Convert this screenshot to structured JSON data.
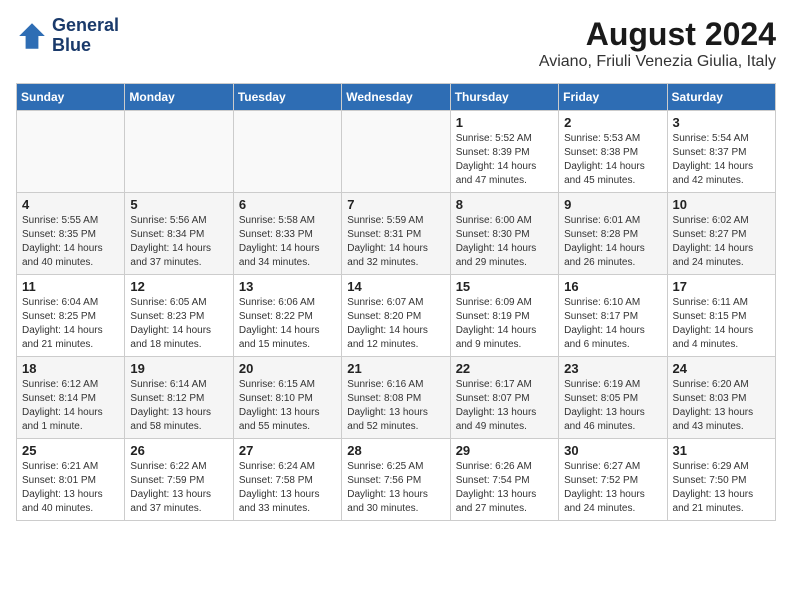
{
  "header": {
    "logo_line1": "General",
    "logo_line2": "Blue",
    "month_title": "August 2024",
    "location": "Aviano, Friuli Venezia Giulia, Italy"
  },
  "days_of_week": [
    "Sunday",
    "Monday",
    "Tuesday",
    "Wednesday",
    "Thursday",
    "Friday",
    "Saturday"
  ],
  "weeks": [
    [
      {
        "day": "",
        "detail": ""
      },
      {
        "day": "",
        "detail": ""
      },
      {
        "day": "",
        "detail": ""
      },
      {
        "day": "",
        "detail": ""
      },
      {
        "day": "1",
        "detail": "Sunrise: 5:52 AM\nSunset: 8:39 PM\nDaylight: 14 hours\nand 47 minutes."
      },
      {
        "day": "2",
        "detail": "Sunrise: 5:53 AM\nSunset: 8:38 PM\nDaylight: 14 hours\nand 45 minutes."
      },
      {
        "day": "3",
        "detail": "Sunrise: 5:54 AM\nSunset: 8:37 PM\nDaylight: 14 hours\nand 42 minutes."
      }
    ],
    [
      {
        "day": "4",
        "detail": "Sunrise: 5:55 AM\nSunset: 8:35 PM\nDaylight: 14 hours\nand 40 minutes."
      },
      {
        "day": "5",
        "detail": "Sunrise: 5:56 AM\nSunset: 8:34 PM\nDaylight: 14 hours\nand 37 minutes."
      },
      {
        "day": "6",
        "detail": "Sunrise: 5:58 AM\nSunset: 8:33 PM\nDaylight: 14 hours\nand 34 minutes."
      },
      {
        "day": "7",
        "detail": "Sunrise: 5:59 AM\nSunset: 8:31 PM\nDaylight: 14 hours\nand 32 minutes."
      },
      {
        "day": "8",
        "detail": "Sunrise: 6:00 AM\nSunset: 8:30 PM\nDaylight: 14 hours\nand 29 minutes."
      },
      {
        "day": "9",
        "detail": "Sunrise: 6:01 AM\nSunset: 8:28 PM\nDaylight: 14 hours\nand 26 minutes."
      },
      {
        "day": "10",
        "detail": "Sunrise: 6:02 AM\nSunset: 8:27 PM\nDaylight: 14 hours\nand 24 minutes."
      }
    ],
    [
      {
        "day": "11",
        "detail": "Sunrise: 6:04 AM\nSunset: 8:25 PM\nDaylight: 14 hours\nand 21 minutes."
      },
      {
        "day": "12",
        "detail": "Sunrise: 6:05 AM\nSunset: 8:23 PM\nDaylight: 14 hours\nand 18 minutes."
      },
      {
        "day": "13",
        "detail": "Sunrise: 6:06 AM\nSunset: 8:22 PM\nDaylight: 14 hours\nand 15 minutes."
      },
      {
        "day": "14",
        "detail": "Sunrise: 6:07 AM\nSunset: 8:20 PM\nDaylight: 14 hours\nand 12 minutes."
      },
      {
        "day": "15",
        "detail": "Sunrise: 6:09 AM\nSunset: 8:19 PM\nDaylight: 14 hours\nand 9 minutes."
      },
      {
        "day": "16",
        "detail": "Sunrise: 6:10 AM\nSunset: 8:17 PM\nDaylight: 14 hours\nand 6 minutes."
      },
      {
        "day": "17",
        "detail": "Sunrise: 6:11 AM\nSunset: 8:15 PM\nDaylight: 14 hours\nand 4 minutes."
      }
    ],
    [
      {
        "day": "18",
        "detail": "Sunrise: 6:12 AM\nSunset: 8:14 PM\nDaylight: 14 hours\nand 1 minute."
      },
      {
        "day": "19",
        "detail": "Sunrise: 6:14 AM\nSunset: 8:12 PM\nDaylight: 13 hours\nand 58 minutes."
      },
      {
        "day": "20",
        "detail": "Sunrise: 6:15 AM\nSunset: 8:10 PM\nDaylight: 13 hours\nand 55 minutes."
      },
      {
        "day": "21",
        "detail": "Sunrise: 6:16 AM\nSunset: 8:08 PM\nDaylight: 13 hours\nand 52 minutes."
      },
      {
        "day": "22",
        "detail": "Sunrise: 6:17 AM\nSunset: 8:07 PM\nDaylight: 13 hours\nand 49 minutes."
      },
      {
        "day": "23",
        "detail": "Sunrise: 6:19 AM\nSunset: 8:05 PM\nDaylight: 13 hours\nand 46 minutes."
      },
      {
        "day": "24",
        "detail": "Sunrise: 6:20 AM\nSunset: 8:03 PM\nDaylight: 13 hours\nand 43 minutes."
      }
    ],
    [
      {
        "day": "25",
        "detail": "Sunrise: 6:21 AM\nSunset: 8:01 PM\nDaylight: 13 hours\nand 40 minutes."
      },
      {
        "day": "26",
        "detail": "Sunrise: 6:22 AM\nSunset: 7:59 PM\nDaylight: 13 hours\nand 37 minutes."
      },
      {
        "day": "27",
        "detail": "Sunrise: 6:24 AM\nSunset: 7:58 PM\nDaylight: 13 hours\nand 33 minutes."
      },
      {
        "day": "28",
        "detail": "Sunrise: 6:25 AM\nSunset: 7:56 PM\nDaylight: 13 hours\nand 30 minutes."
      },
      {
        "day": "29",
        "detail": "Sunrise: 6:26 AM\nSunset: 7:54 PM\nDaylight: 13 hours\nand 27 minutes."
      },
      {
        "day": "30",
        "detail": "Sunrise: 6:27 AM\nSunset: 7:52 PM\nDaylight: 13 hours\nand 24 minutes."
      },
      {
        "day": "31",
        "detail": "Sunrise: 6:29 AM\nSunset: 7:50 PM\nDaylight: 13 hours\nand 21 minutes."
      }
    ]
  ]
}
